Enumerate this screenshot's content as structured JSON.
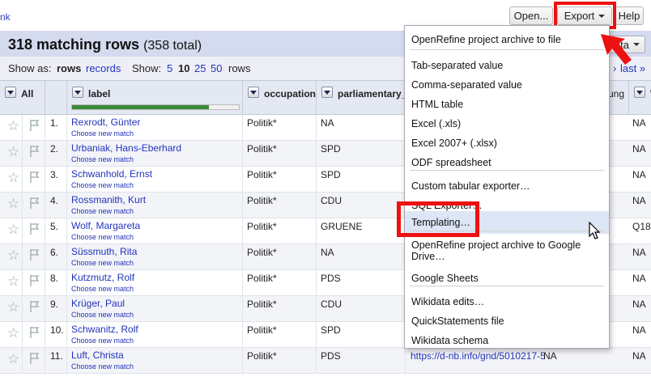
{
  "toolbar": {
    "link_fragment": "nk",
    "open_label": "Open...",
    "export_label": "Export",
    "help_label": "Help"
  },
  "summary": {
    "matching": "318 matching rows",
    "total": "(358 total)",
    "meta_label": "eta"
  },
  "view": {
    "show_as": "Show as:",
    "rows": "rows",
    "records": "records",
    "show": "Show:",
    "sizes": [
      "5",
      "10",
      "25",
      "50"
    ],
    "unit": "rows",
    "next": "›",
    "last": "last »"
  },
  "columns": {
    "all": "All",
    "label": "label",
    "occupation": "occupation",
    "parliamentary": "parliamentary_g",
    "partial_hidden": "ung",
    "last_col": "W"
  },
  "reconciliation_fraction": 0.82,
  "rows": [
    {
      "num": "1.",
      "label": "Rexrodt, Günter",
      "choose": "Choose new match",
      "occupation": "Politik*",
      "party": "NA",
      "right": "NA"
    },
    {
      "num": "2.",
      "label": "Urbaniak, Hans-Eberhard",
      "choose": "Choose new match",
      "occupation": "Politik*",
      "party": "SPD",
      "right": "NA"
    },
    {
      "num": "3.",
      "label": "Schwanhold, Ernst",
      "choose": "Choose new match",
      "occupation": "Politik*",
      "party": "SPD",
      "right": "NA"
    },
    {
      "num": "4.",
      "label": "Rossmanith, Kurt",
      "choose": "Choose new match",
      "occupation": "Politik*",
      "party": "CDU",
      "right": "NA"
    },
    {
      "num": "5.",
      "label": "Wolf, Margareta",
      "choose": "Choose new match",
      "occupation": "Politik*",
      "party": "GRUENE",
      "right": "Q18"
    },
    {
      "num": "6.",
      "label": "Süssmuth, Rita",
      "choose": "Choose new match",
      "occupation": "Politik*",
      "party": "NA",
      "right": "NA"
    },
    {
      "num": "8.",
      "label": "Kutzmutz, Rolf",
      "choose": "Choose new match",
      "occupation": "Politik*",
      "party": "PDS",
      "right": "NA"
    },
    {
      "num": "9.",
      "label": "Krüger, Paul",
      "choose": "Choose new match",
      "occupation": "Politik*",
      "party": "CDU",
      "right": "NA"
    },
    {
      "num": "10.",
      "label": "Schwanitz, Rolf",
      "choose": "Choose new match",
      "occupation": "Politik*",
      "party": "SPD",
      "right": "NA"
    },
    {
      "num": "11.",
      "label": "Luft, Christa",
      "choose": "Choose new match",
      "occupation": "Politik*",
      "party": "PDS",
      "right": "NA",
      "extra": "https://d-nb.info/gnd/5010217-5",
      "extra2": "NA"
    }
  ],
  "export_menu": [
    "OpenRefine project archive to file",
    "Tab-separated value",
    "Comma-separated value",
    "HTML table",
    "Excel (.xls)",
    "Excel 2007+ (.xlsx)",
    "ODF spreadsheet",
    "Custom tabular exporter…",
    "SQL Exporter…",
    "Templating…",
    "OpenRefine project archive to Google Drive…",
    "Google Sheets",
    "Wikidata edits…",
    "QuickStatements file",
    "Wikidata schema"
  ],
  "colors": {
    "highlight": "#ee1111",
    "header_band": "#d4dbef",
    "link": "#2233bb",
    "recon_green": "#3a8a3a"
  }
}
